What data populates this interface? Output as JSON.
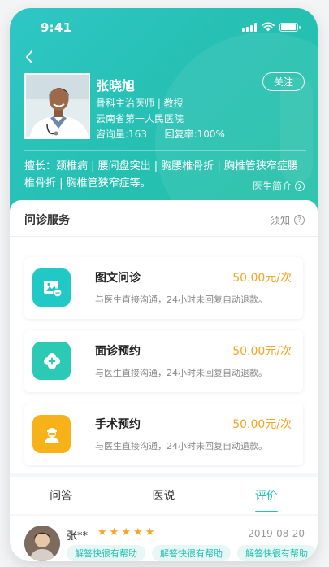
{
  "status_bar": {
    "time": "9:41"
  },
  "doctor": {
    "name": "张晓旭",
    "title": "骨科主治医师 | 教授",
    "hospital": "云南省第一人民医院",
    "consultations": "咨询量:163",
    "reply_rate": "回复率:100%",
    "follow_label": "关注",
    "specialty": "擅长：颈椎病 | 腰间盘突出 | 胸腰椎骨折 | 胸椎管狭窄症腰椎骨折 | 胸椎管狭窄症等。",
    "intro_link": "医生简介"
  },
  "services": {
    "title": "问诊服务",
    "notice_label": "须知",
    "items": [
      {
        "name": "图文问诊",
        "price": "50.00元/次",
        "desc": "与医生直接沟通，24小时未回复自动退款。",
        "icon": "image-chat-icon",
        "color": "#20c9c6"
      },
      {
        "name": "面诊预约",
        "price": "50.00元/次",
        "desc": "与医生直接沟通，24小时未回复自动退款。",
        "icon": "medical-cross-icon",
        "color": "#2ccab5"
      },
      {
        "name": "手术预约",
        "price": "50.00元/次",
        "desc": "与医生直接沟通，24小时未回复自动退款。",
        "icon": "surgeon-icon",
        "color": "#f8b219"
      }
    ]
  },
  "tabs": [
    {
      "label": "问答",
      "active": false
    },
    {
      "label": "医说",
      "active": false
    },
    {
      "label": "评价",
      "active": true
    }
  ],
  "review": {
    "user": "张**",
    "rating": 5,
    "date": "2019-08-20",
    "tags": [
      "解答快很有帮助",
      "解答快很有帮助",
      "解答快很有帮助"
    ]
  },
  "colors": {
    "accent": "#22c0b0",
    "price": "#f5a623"
  }
}
